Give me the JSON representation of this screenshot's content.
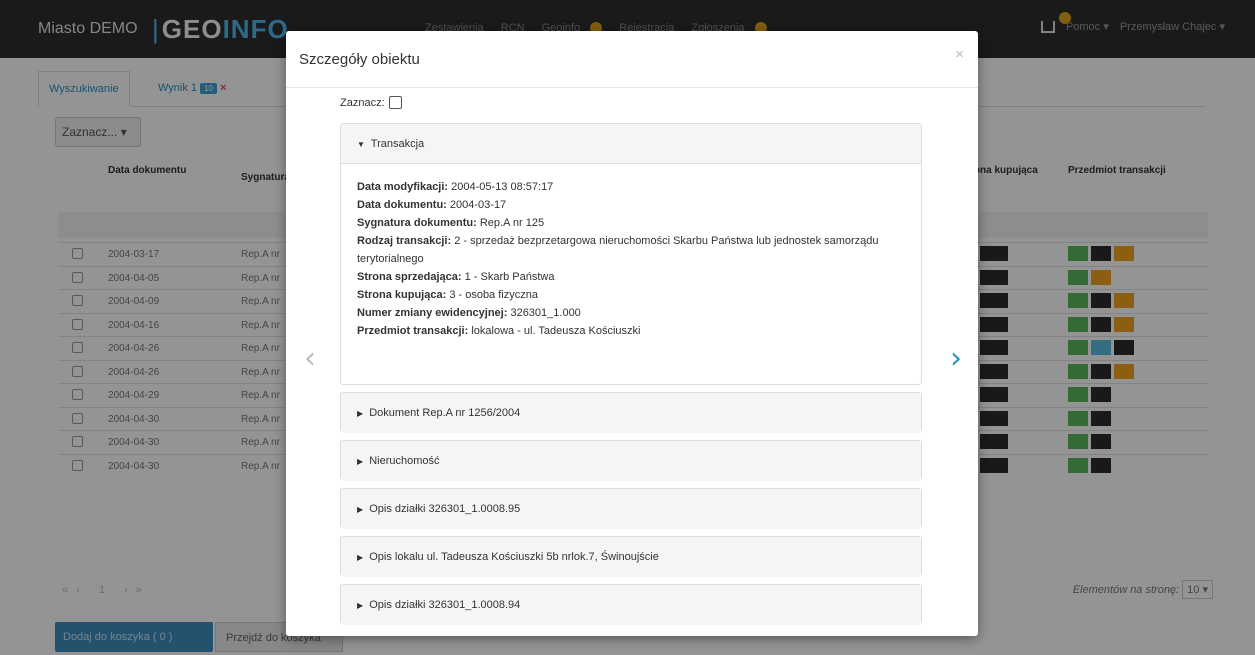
{
  "navbar": {
    "city": "Miasto DEMO",
    "logo_bar": "|",
    "logo_geo": "GEO",
    "logo_info": "INFO",
    "menu": [
      "Zestawienia",
      "RCN",
      "Geoinfo",
      "Rejestracja",
      "Zgłoszenia"
    ],
    "help": "Pomoc ▾",
    "user": "Przemysław Chajec ▾"
  },
  "background": {
    "tab_search": "Wyszukiwanie",
    "tab_result": "Wynik 1",
    "tab_result_badge": "10",
    "tab_result_close": "×",
    "select_button": "Zaznacz... ▾",
    "col_date": "Data dokumentu",
    "col_sig": "Sygnatura dokumentu",
    "col_buyer": "Strona kupująca",
    "col_subject": "Przedmiot transakcji",
    "rows": [
      {
        "date": "2004-03-17",
        "sig": "Rep.A nr",
        "tags": [
          "g",
          "d",
          "o"
        ]
      },
      {
        "date": "2004-04-05",
        "sig": "Rep.A nr",
        "tags": [
          "g",
          "o"
        ]
      },
      {
        "date": "2004-04-09",
        "sig": "Rep.A nr",
        "tags": [
          "g",
          "d",
          "o"
        ]
      },
      {
        "date": "2004-04-16",
        "sig": "Rep.A nr",
        "tags": [
          "g",
          "d",
          "o"
        ]
      },
      {
        "date": "2004-04-26",
        "sig": "Rep.A nr",
        "tags": [
          "g",
          "b",
          "d"
        ]
      },
      {
        "date": "2004-04-26",
        "sig": "Rep.A nr",
        "tags": [
          "g",
          "d",
          "o"
        ]
      },
      {
        "date": "2004-04-29",
        "sig": "Rep.A nr",
        "tags": [
          "g",
          "d"
        ]
      },
      {
        "date": "2004-04-30",
        "sig": "Rep.A nr",
        "tags": [
          "g",
          "d"
        ]
      },
      {
        "date": "2004-04-30",
        "sig": "Rep.A nr",
        "tags": [
          "g",
          "d"
        ]
      },
      {
        "date": "2004-04-30",
        "sig": "Rep.A nr",
        "tags": [
          "g",
          "d"
        ]
      }
    ],
    "pager": "«‹ 1 ›»",
    "per_page_label": "Elementów na stronę:",
    "per_page_value": "10 ▾",
    "cart_button": "Dodaj do koszyka ( 0 )",
    "goto_button": "Przejdź do koszyka"
  },
  "modal": {
    "title": "Szczegóły obiektu",
    "close": "×",
    "mark_label": "Zaznacz:",
    "prev": "‹",
    "next": "›",
    "transaction": {
      "header": "Transakcja",
      "fields": [
        {
          "label": "Data modyfikacji:",
          "value": "2004-05-13 08:57:17"
        },
        {
          "label": "Data dokumentu:",
          "value": "2004-03-17"
        },
        {
          "label": "Sygnatura dokumentu:",
          "value": "Rep.A nr 125"
        },
        {
          "label": "Rodzaj transakcji:",
          "value": "2 - sprzedaż bezprzetargowa nieruchomości Skarbu Państwa lub jednostek samorządu terytorialnego"
        },
        {
          "label": "Strona sprzedająca:",
          "value": "1 - Skarb Państwa"
        },
        {
          "label": "Strona kupująca:",
          "value": "3 - osoba fizyczna"
        },
        {
          "label": "Numer zmiany ewidencyjnej:",
          "value": "326301_1.000"
        },
        {
          "label": "Przedmiot transakcji:",
          "value": "lokalowa - ul. Tadeusza Kościuszki"
        }
      ]
    },
    "sections": [
      "Dokument Rep.A nr 1256/2004",
      "Nieruchomość",
      "Opis działki 326301_1.0008.95",
      "Opis lokalu ul. Tadeusza Kościuszki 5b nrlok.7, Świnoujście",
      "Opis działki 326301_1.0008.94"
    ]
  }
}
